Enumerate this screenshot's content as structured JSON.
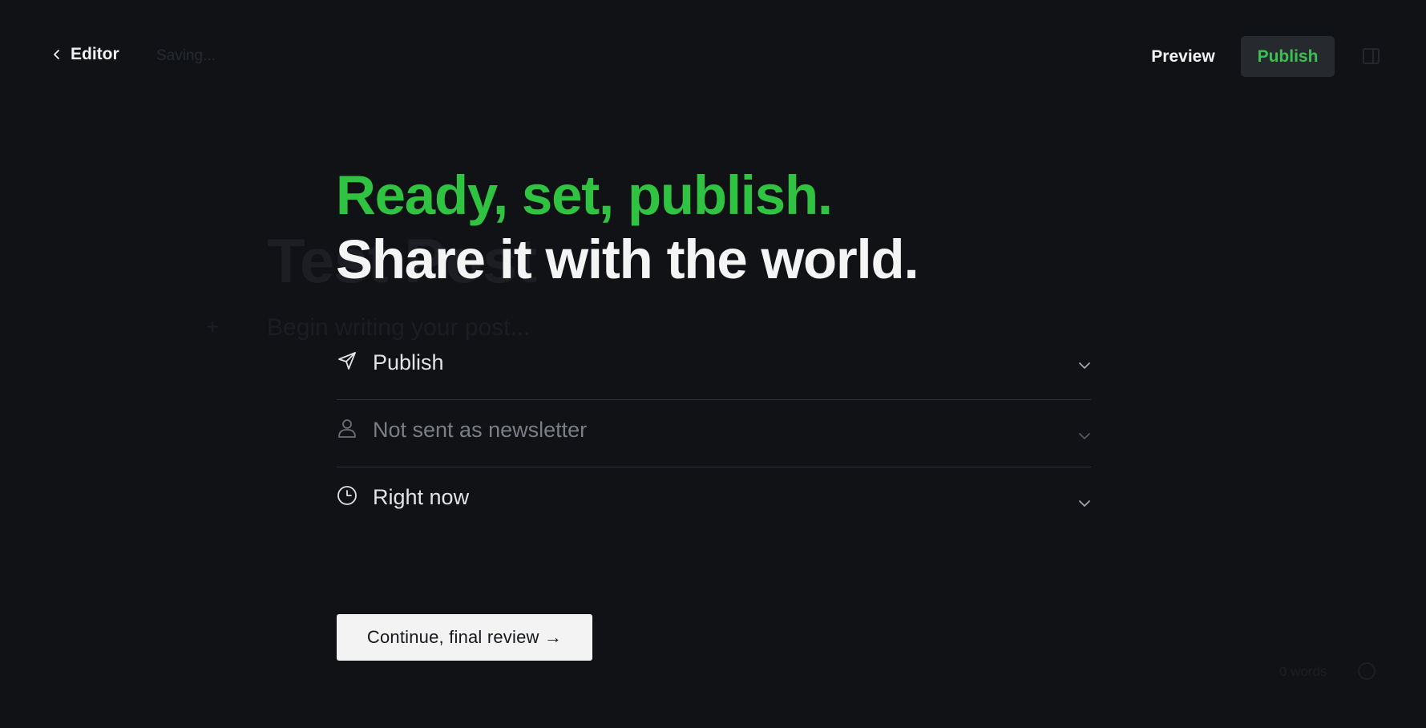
{
  "topbar": {
    "back_label": "Editor",
    "status": "Saving...",
    "preview_label": "Preview",
    "publish_label": "Publish"
  },
  "background_editor": {
    "title": "Test Post",
    "prompt": "Begin writing your post..."
  },
  "footer_ghost": {
    "word_count": "0 words",
    "help": "?"
  },
  "heading": {
    "line1": "Ready, set, publish.",
    "line2": "Share it with the world."
  },
  "settings": [
    {
      "icon": "paper-plane-icon",
      "label": "Publish",
      "muted": false
    },
    {
      "icon": "user-icon",
      "label": "Not sent as newsletter",
      "muted": true
    },
    {
      "icon": "clock-icon",
      "label": "Right now",
      "muted": false
    }
  ],
  "continue_button": "Continue, final review →",
  "colors": {
    "background": "#111216",
    "accent_green": "#30c241",
    "publish_button_bg": "#26292e",
    "text_primary": "#f4f4f5",
    "text_muted": "#7b7e85",
    "divider": "#2c2f35"
  }
}
